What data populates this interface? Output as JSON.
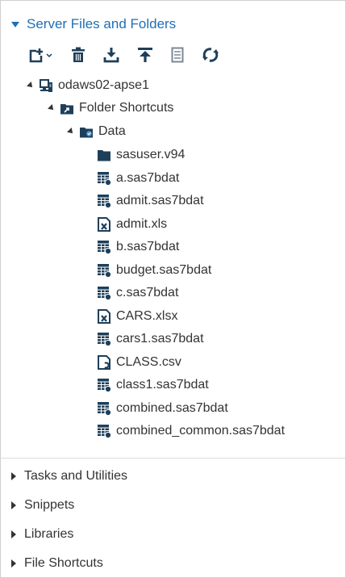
{
  "panel": {
    "title": "Server Files and Folders"
  },
  "toolbar": {
    "buttons": [
      {
        "icon": "new-menu-icon"
      },
      {
        "icon": "delete-icon"
      },
      {
        "icon": "download-icon"
      },
      {
        "icon": "upload-icon"
      },
      {
        "icon": "properties-icon"
      },
      {
        "icon": "refresh-icon"
      }
    ]
  },
  "tree": {
    "server": {
      "label": "odaws02-apse1",
      "icon": "server-icon"
    },
    "shortcuts": {
      "label": "Folder Shortcuts",
      "icon": "folder-shortcut-icon"
    },
    "data": {
      "label": "Data",
      "icon": "data-folder-icon"
    },
    "files": [
      {
        "label": "sasuser.v94",
        "icon": "folder-icon"
      },
      {
        "label": "a.sas7bdat",
        "icon": "sas-table-icon"
      },
      {
        "label": "admit.sas7bdat",
        "icon": "sas-table-icon"
      },
      {
        "label": "admit.xls",
        "icon": "excel-file-icon"
      },
      {
        "label": "b.sas7bdat",
        "icon": "sas-table-icon"
      },
      {
        "label": "budget.sas7bdat",
        "icon": "sas-table-icon"
      },
      {
        "label": "c.sas7bdat",
        "icon": "sas-table-icon"
      },
      {
        "label": "CARS.xlsx",
        "icon": "excel-file-icon"
      },
      {
        "label": "cars1.sas7bdat",
        "icon": "sas-table-icon"
      },
      {
        "label": "CLASS.csv",
        "icon": "csv-file-icon"
      },
      {
        "label": "class1.sas7bdat",
        "icon": "sas-table-icon"
      },
      {
        "label": "combined.sas7bdat",
        "icon": "sas-table-icon"
      },
      {
        "label": "combined_common.sas7bdat",
        "icon": "sas-table-icon"
      }
    ]
  },
  "sections": [
    {
      "label": "Tasks and Utilities"
    },
    {
      "label": "Snippets"
    },
    {
      "label": "Libraries"
    },
    {
      "label": "File Shortcuts"
    }
  ],
  "colors": {
    "accent": "#1f6fb5",
    "icon_dark": "#1e3f5a",
    "text": "#333333"
  }
}
